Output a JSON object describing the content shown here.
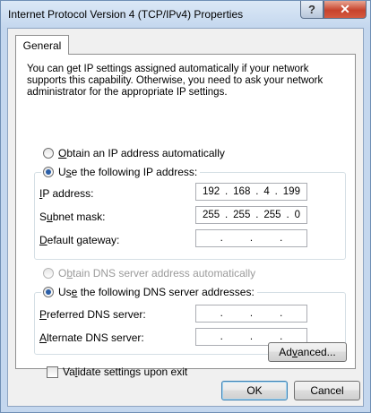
{
  "window": {
    "title": "Internet Protocol Version 4 (TCP/IPv4) Properties",
    "help_label": "?",
    "close_label": "✕"
  },
  "tabs": [
    {
      "label": "General",
      "selected": true
    }
  ],
  "general": {
    "description": "You can get IP settings assigned automatically if your network supports this capability. Otherwise, you need to ask your network administrator for the appropriate IP settings.",
    "ip_auto": {
      "label_u": "O",
      "label_rest": "btain an IP address automatically",
      "checked": false
    },
    "ip_manual": {
      "label_pre": "U",
      "label_u": "s",
      "label_rest": "e the following IP address:",
      "checked": true
    },
    "ip_address": {
      "label_u": "I",
      "label_rest": "P address:",
      "octets": [
        "192",
        "168",
        "4",
        "199"
      ]
    },
    "subnet_mask": {
      "label_pre": "S",
      "label_u": "u",
      "label_rest": "bnet mask:",
      "octets": [
        "255",
        "255",
        "255",
        "0"
      ]
    },
    "default_gateway": {
      "label_u": "D",
      "label_rest": "efault gateway:",
      "octets": [
        "",
        "",
        "",
        ""
      ]
    },
    "dns_auto": {
      "label_pre": "O",
      "label_u": "b",
      "label_rest": "tain DNS server address automatically",
      "checked": false,
      "enabled": false
    },
    "dns_manual": {
      "label_pre": "Us",
      "label_u": "e",
      "label_rest": " the following DNS server addresses:",
      "checked": true
    },
    "preferred_dns": {
      "label_u": "P",
      "label_rest": "referred DNS server:",
      "octets": [
        "",
        "",
        "",
        ""
      ]
    },
    "alternate_dns": {
      "label_u": "A",
      "label_rest": "lternate DNS server:",
      "octets": [
        "",
        "",
        "",
        ""
      ]
    },
    "validate": {
      "label_pre": "Va",
      "label_u": "l",
      "label_rest": "idate settings upon exit",
      "checked": false
    },
    "advanced_label_pre": "Ad",
    "advanced_label_u": "v",
    "advanced_label_rest": "anced..."
  },
  "footer": {
    "ok_label": "OK",
    "cancel_label": "Cancel"
  },
  "ip_separator": "."
}
